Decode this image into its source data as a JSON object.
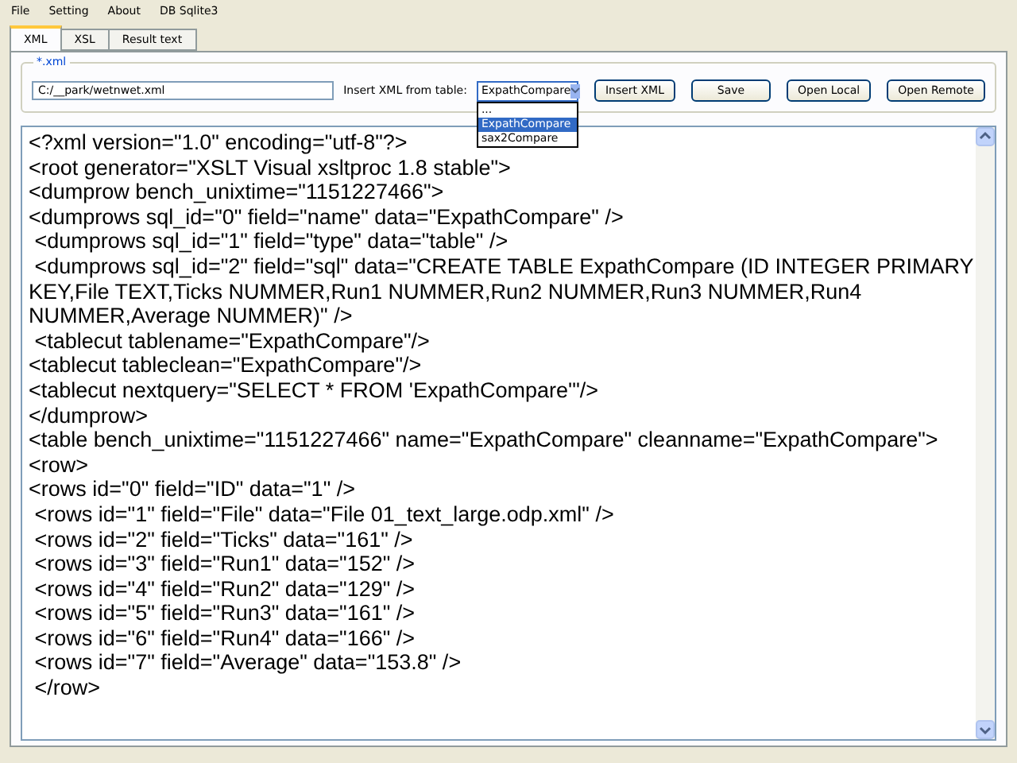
{
  "menu": [
    "File",
    "Setting",
    "About",
    "DB Sqlite3"
  ],
  "tabs": [
    {
      "label": "XML",
      "selected": true
    },
    {
      "label": "XSL",
      "selected": false
    },
    {
      "label": "Result text",
      "selected": false
    }
  ],
  "file_group": {
    "legend": "*.xml",
    "path": "C:/__park/wetnwet.xml"
  },
  "table_select": {
    "label": "Insert XML from table:",
    "value": "ExpathCompare",
    "expanded": true,
    "options": [
      {
        "label": "...",
        "selected": false
      },
      {
        "label": "ExpathCompare",
        "selected": true
      },
      {
        "label": "sax2Compare",
        "selected": false
      }
    ]
  },
  "buttons": [
    "Insert XML",
    "Save",
    "Open Local",
    "Open Remote"
  ],
  "editor_lines": [
    "<?xml version=\"1.0\" encoding=\"utf-8\"?>",
    "<root generator=\"XSLT Visual xsltproc 1.8 stable\">",
    "<dumprow bench_unixtime=\"1151227466\">",
    "<dumprows sql_id=\"0\" field=\"name\" data=\"ExpathCompare\" />",
    " <dumprows sql_id=\"1\" field=\"type\" data=\"table\" />",
    " <dumprows sql_id=\"2\" field=\"sql\" data=\"CREATE TABLE ExpathCompare (ID INTEGER PRIMARY KEY,File TEXT,Ticks NUMMER,Run1 NUMMER,Run2 NUMMER,Run3 NUMMER,Run4 NUMMER,Average NUMMER)\" />",
    " <tablecut tablename=\"ExpathCompare\"/>",
    "<tablecut tableclean=\"ExpathCompare\"/>",
    "<tablecut nextquery=\"SELECT * FROM 'ExpathCompare'\"/>",
    "</dumprow>",
    "<table bench_unixtime=\"1151227466\" name=\"ExpathCompare\" cleanname=\"ExpathCompare\">",
    "<row>",
    "<rows id=\"0\" field=\"ID\" data=\"1\" />",
    " <rows id=\"1\" field=\"File\" data=\"File 01_text_large.odp.xml\" />",
    " <rows id=\"2\" field=\"Ticks\" data=\"161\" />",
    " <rows id=\"3\" field=\"Run1\" data=\"152\" />",
    " <rows id=\"4\" field=\"Run2\" data=\"129\" />",
    " <rows id=\"5\" field=\"Run3\" data=\"161\" />",
    " <rows id=\"6\" field=\"Run4\" data=\"166\" />",
    " <rows id=\"7\" field=\"Average\" data=\"153.8\" />",
    " </row>"
  ]
}
